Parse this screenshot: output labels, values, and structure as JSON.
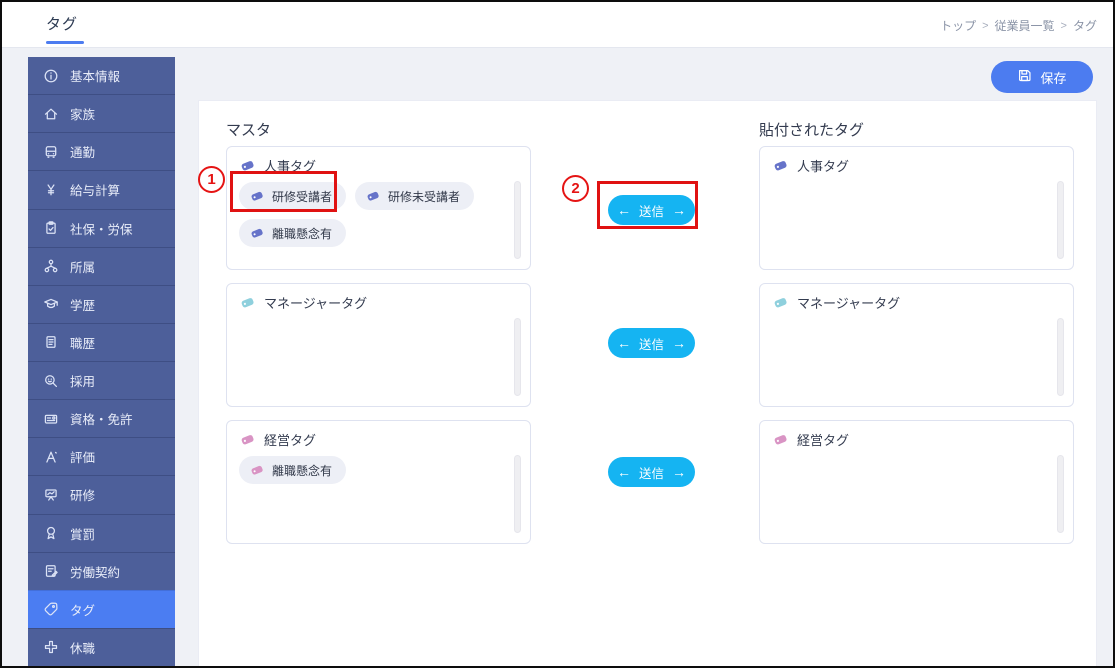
{
  "page": {
    "title": "タグ",
    "breadcrumb": [
      "トップ",
      "従業員一覧",
      "タグ"
    ],
    "breadcrumb_separator": ">"
  },
  "toolbar": {
    "save_label": "保存"
  },
  "sidebar": {
    "items": [
      {
        "label": "基本情報",
        "icon": "info-icon"
      },
      {
        "label": "家族",
        "icon": "home-icon"
      },
      {
        "label": "通勤",
        "icon": "bus-icon"
      },
      {
        "label": "給与計算",
        "icon": "yen-icon"
      },
      {
        "label": "社保・労保",
        "icon": "clipboard-icon"
      },
      {
        "label": "所属",
        "icon": "org-chart-icon"
      },
      {
        "label": "学歴",
        "icon": "graduation-cap-icon"
      },
      {
        "label": "職歴",
        "icon": "resume-icon"
      },
      {
        "label": "採用",
        "icon": "recruit-search-icon"
      },
      {
        "label": "資格・免許",
        "icon": "license-card-icon"
      },
      {
        "label": "評価",
        "icon": "grade-a-icon"
      },
      {
        "label": "研修",
        "icon": "training-board-icon"
      },
      {
        "label": "賞罰",
        "icon": "award-medal-icon"
      },
      {
        "label": "労働契約",
        "icon": "contract-pen-icon"
      },
      {
        "label": "タグ",
        "icon": "tag-icon",
        "active": true
      },
      {
        "label": "休職",
        "icon": "plus-cross-icon"
      }
    ]
  },
  "main": {
    "master_title": "マスタ",
    "attached_title": "貼付されたタグ",
    "send_label": "送信",
    "groups": [
      {
        "name": "人事タグ",
        "color": "#6673c9",
        "master_tags": [
          "研修受講者",
          "研修未受講者",
          "離職懸念有"
        ],
        "attached_tags": []
      },
      {
        "name": "マネージャータグ",
        "color": "#8fd0dd",
        "master_tags": [],
        "attached_tags": []
      },
      {
        "name": "経営タグ",
        "color": "#d994c4",
        "master_tags": [
          "離職懸念有"
        ],
        "attached_tags": []
      }
    ]
  },
  "annotations": {
    "callout_1": "1",
    "callout_2": "2"
  },
  "colors": {
    "accent_blue": "#4c7cf0",
    "send_cyan": "#15b4f2",
    "annotation_red": "#e51414",
    "sidebar_blue": "#4d5f9a",
    "sidebar_active_blue": "#4b7df2"
  }
}
